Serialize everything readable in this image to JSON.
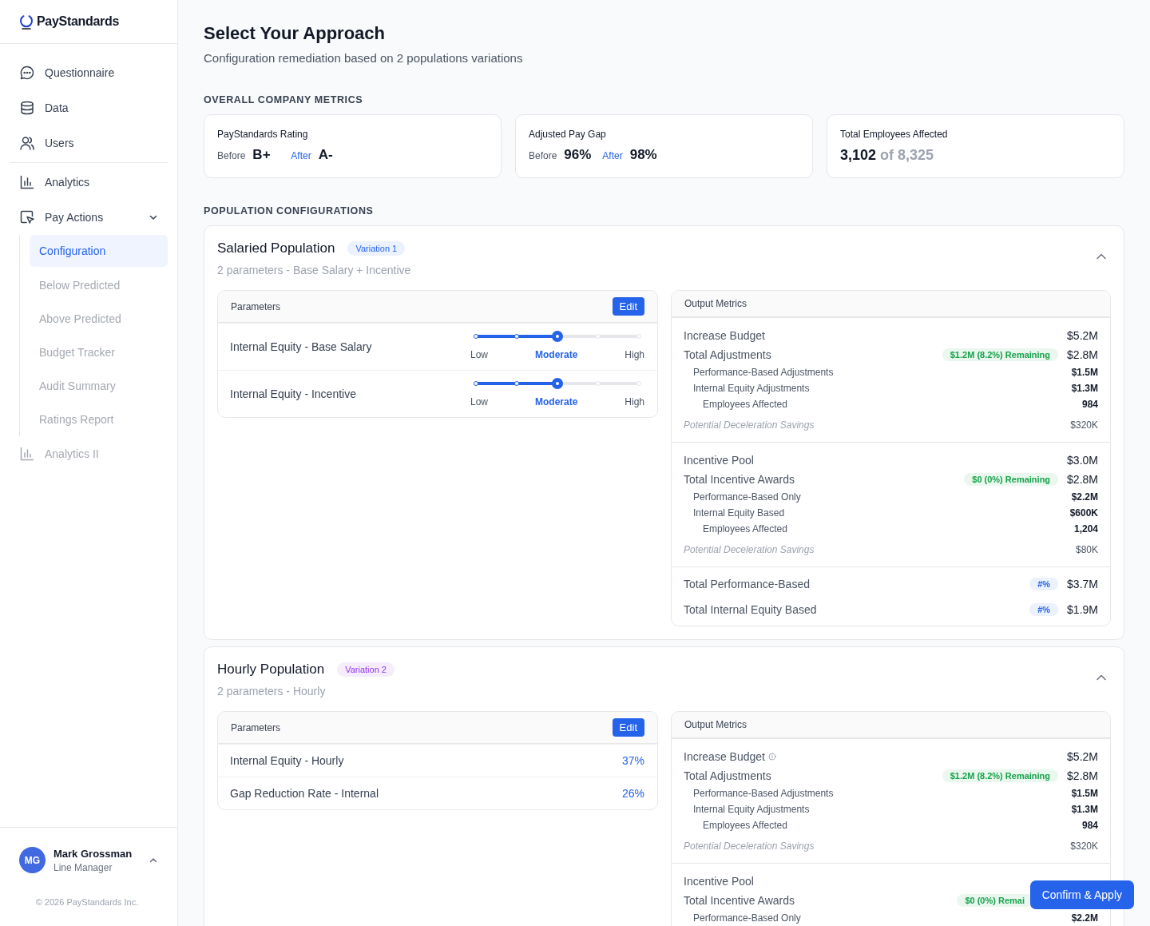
{
  "brand": {
    "name": "PayStandards"
  },
  "sidebar": {
    "sections": [
      {
        "items": [
          {
            "label": "Questionnaire",
            "selected": false,
            "disabled": false
          },
          {
            "label": "Data",
            "selected": false,
            "disabled": false
          },
          {
            "label": "Users",
            "selected": false,
            "disabled": false
          }
        ]
      },
      {
        "items": [
          {
            "label": "Analytics",
            "selected": false,
            "disabled": false
          },
          {
            "label": "Pay Actions",
            "selected": false,
            "disabled": false,
            "expanded": true,
            "children": [
              {
                "label": "Configuration",
                "selected": true,
                "disabled": false
              },
              {
                "label": "Below Predicted",
                "selected": false,
                "disabled": true
              },
              {
                "label": "Above Predicted",
                "selected": false,
                "disabled": true
              },
              {
                "label": "Budget Tracker",
                "selected": false,
                "disabled": true
              },
              {
                "label": "Audit Summary",
                "selected": false,
                "disabled": true
              },
              {
                "label": "Ratings Report",
                "selected": false,
                "disabled": true
              }
            ]
          },
          {
            "label": "Analytics II",
            "selected": false,
            "disabled": true
          }
        ]
      }
    ]
  },
  "user": {
    "initials": "MG",
    "name": "Mark Grossman",
    "role": "Line Manager"
  },
  "copyright": "© 2026 PayStandards Inc.",
  "header": {
    "title": "Select Your Approach",
    "subtitle": "Configuration remediation based on 2 populations variations"
  },
  "company_metrics": {
    "heading": "OVERALL COMPANY METRICS",
    "cards": [
      {
        "kind": "before_after",
        "title": "PayStandards Rating",
        "before_label": "Before",
        "before": "B+",
        "after_label": "After",
        "after": "A-"
      },
      {
        "kind": "before_after",
        "title": "Adjusted Pay Gap",
        "before_label": "Before",
        "before": "96%",
        "after_label": "After",
        "after": "98%"
      },
      {
        "kind": "count",
        "title": "Total Employees Affected",
        "value": "3,102",
        "total": "of 8,325"
      }
    ]
  },
  "populations_heading": "POPULATION CONFIGURATIONS",
  "populations": [
    {
      "title": "Salaried Population",
      "badge": {
        "text": "Variation 1",
        "color": "#2563eb"
      },
      "expanded": true,
      "subtitle": "2 parameters - Base Salary + Incentive",
      "parameters": {
        "title": "Parameters",
        "edit": "Edit",
        "rows": [
          {
            "kind": "slider",
            "label": "Internal Equity - Base Salary",
            "level": 0.5,
            "stops": [
              {
                "text": "Low",
                "selected": false
              },
              {
                "text": "Moderate",
                "selected": true
              },
              {
                "text": "High",
                "selected": false
              }
            ]
          },
          {
            "kind": "slider",
            "label": "Internal Equity - Incentive",
            "level": 0.5,
            "stops": [
              {
                "text": "Low",
                "selected": false
              },
              {
                "text": "Moderate",
                "selected": true
              },
              {
                "text": "High",
                "selected": false
              }
            ]
          }
        ]
      },
      "outputs": {
        "title": "Output Metrics",
        "groups": [
          {
            "rows": [
              {
                "kind": "metric",
                "label": "Increase Budget",
                "value": "$5.2M"
              },
              {
                "kind": "metric",
                "label": "Total Adjustments",
                "value": "$2.8M",
                "badge": {
                  "text": "$1.2M (8.2%) Remaining",
                  "color": "#16a34a"
                },
                "children": [
                  {
                    "label": "Performance-Based Adjustments",
                    "value": "$1.5M"
                  },
                  {
                    "label": "Internal Equity Adjustments",
                    "value": "$1.3M",
                    "children": [
                      {
                        "label": "Employees Affected",
                        "value": "984"
                      }
                    ]
                  }
                ]
              },
              {
                "kind": "note",
                "label": "Potential Deceleration Savings",
                "value": "$320K"
              }
            ]
          },
          {
            "rows": [
              {
                "kind": "metric",
                "label": "Incentive Pool",
                "value": "$3.0M"
              },
              {
                "kind": "metric",
                "label": "Total Incentive Awards",
                "value": "$2.8M",
                "badge": {
                  "text": "$0 (0%) Remaining",
                  "color": "#16a34a"
                },
                "children": [
                  {
                    "label": "Performance-Based Only",
                    "value": "$2.2M"
                  },
                  {
                    "label": "Internal Equity Based",
                    "value": "$600K",
                    "children": [
                      {
                        "label": "Employees Affected",
                        "value": "1,204"
                      }
                    ]
                  }
                ]
              },
              {
                "kind": "note",
                "label": "Potential Deceleration Savings",
                "value": "$80K"
              }
            ]
          },
          {
            "rows": [
              {
                "kind": "total",
                "label": "Total Performance-Based",
                "value": "$3.7M",
                "badge": {
                  "text": "#%",
                  "color": "#2563eb"
                }
              },
              {
                "kind": "total",
                "label": "Total Internal Equity Based",
                "value": "$1.9M",
                "badge": {
                  "text": "#%",
                  "color": "#2563eb"
                }
              }
            ]
          }
        ]
      }
    },
    {
      "title": "Hourly Population",
      "badge": {
        "text": "Variation 2",
        "color": "#9333ea"
      },
      "expanded": true,
      "subtitle": "2 parameters - Hourly",
      "parameters": {
        "title": "Parameters",
        "edit": "Edit",
        "rows": [
          {
            "kind": "percent",
            "label": "Internal Equity - Hourly",
            "value": "37%"
          },
          {
            "kind": "percent",
            "label": "Gap Reduction Rate - Internal",
            "value": "26%"
          }
        ]
      },
      "outputs": {
        "title": "Output Metrics",
        "groups": [
          {
            "rows": [
              {
                "kind": "metric",
                "label": "Increase Budget",
                "value": "$5.2M",
                "info": true
              },
              {
                "kind": "metric",
                "label": "Total Adjustments",
                "value": "$2.8M",
                "badge": {
                  "text": "$1.2M (8.2%) Remaining",
                  "color": "#16a34a"
                },
                "children": [
                  {
                    "label": "Performance-Based Adjustments",
                    "value": "$1.5M"
                  },
                  {
                    "label": "Internal Equity Adjustments",
                    "value": "$1.3M",
                    "children": [
                      {
                        "label": "Employees Affected",
                        "value": "984"
                      }
                    ]
                  }
                ]
              },
              {
                "kind": "note",
                "label": "Potential Deceleration Savings",
                "value": "$320K"
              }
            ]
          },
          {
            "rows": [
              {
                "kind": "metric",
                "label": "Incentive Pool"
              },
              {
                "kind": "metric",
                "label": "Total Incentive Awards",
                "badge": {
                  "text": "$0 (0%) Remai",
                  "color": "#16a34a"
                },
                "children": [
                  {
                    "label": "Performance-Based Only",
                    "value": "$2.2M"
                  }
                ]
              }
            ]
          }
        ]
      }
    }
  ],
  "confirm_button": "Confirm & Apply"
}
